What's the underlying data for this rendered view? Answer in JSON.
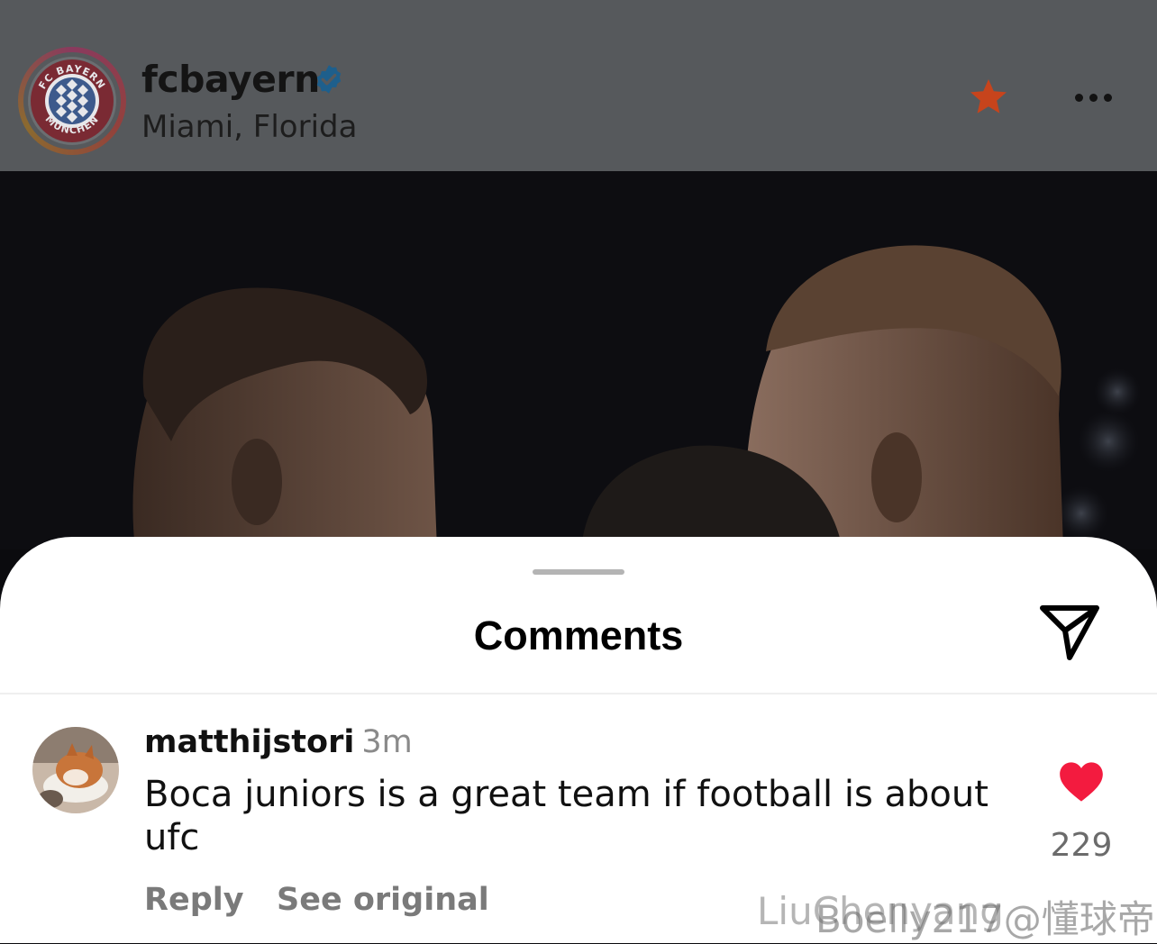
{
  "post": {
    "username": "fcbayern",
    "location": "Miami, Florida",
    "avatar_icon": "fc-bayern-muenchen-logo",
    "verified_icon": "verified-badge-icon",
    "favorite_icon": "star-icon",
    "more_icon": "more-options-icon",
    "accent_color": "#d9491a"
  },
  "comments_sheet": {
    "title": "Comments",
    "share_icon": "send-icon"
  },
  "comment": {
    "username": "matthijstori",
    "time": "3m",
    "text": "Boca juniors is a great team if football is about ufc",
    "like_count": "229",
    "liked": true,
    "like_color": "#f31b3f",
    "reply_label": "Reply",
    "see_original_label": "See original"
  },
  "watermarks": [
    "LiuChenyang",
    "Boelly217@懂球帝"
  ]
}
